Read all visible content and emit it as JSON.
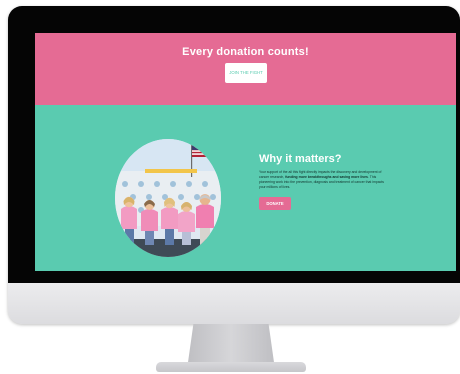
{
  "hero": {
    "title": "Every donation counts!",
    "join_button_label": "JOIN THE FIGHT",
    "background_color": "#e56b94"
  },
  "mission": {
    "title": "Why it matters?",
    "body_before": "Your support of the ail this fight directly impacts the discovery and development of cancer research, ",
    "body_bold": "funding more breakthroughs and saving more lives",
    "body_after": ". This pioneering work into the prevention, diagnosis and treatment of cancer that impacts your millions of lives.",
    "donate_button_label": "DONATE",
    "background_color": "#5acbb0",
    "photo_icon": "team-photo-icon"
  },
  "colors": {
    "accent_pink": "#e56b94",
    "accent_teal": "#5acbb0",
    "bezel": "#050505",
    "stand": "#c9c9cc"
  }
}
